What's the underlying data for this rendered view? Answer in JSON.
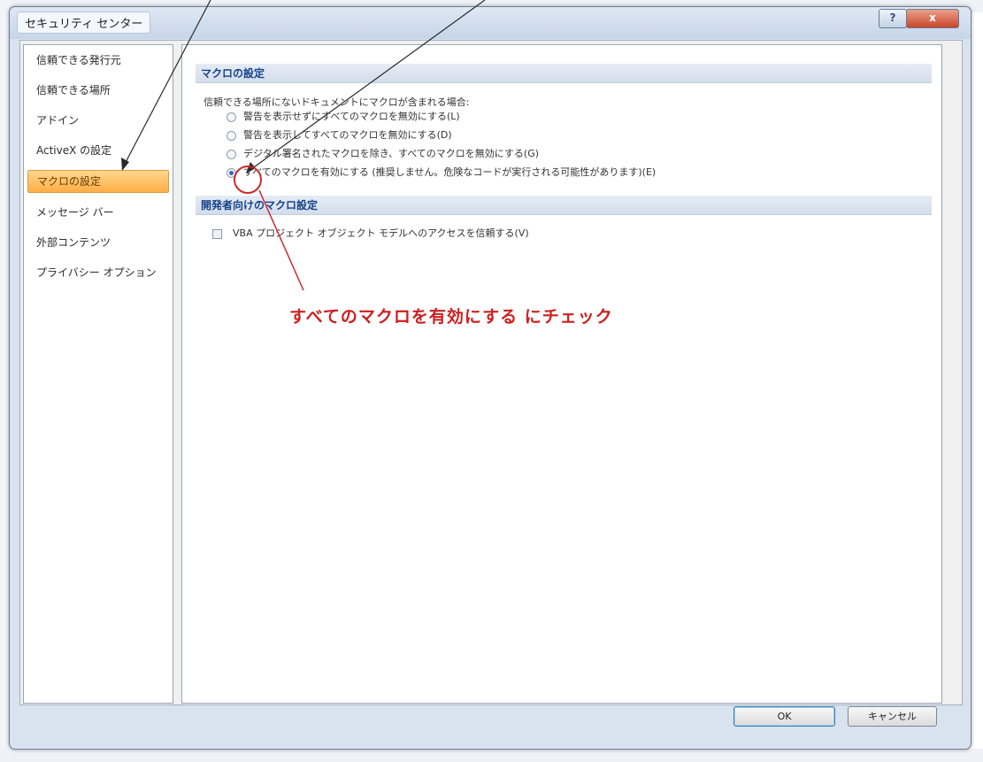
{
  "window": {
    "title": "セキュリティ センター",
    "help_button": "?",
    "close_button": "x"
  },
  "sidebar": {
    "items": [
      {
        "label": "信頼できる発行元"
      },
      {
        "label": "信頼できる場所"
      },
      {
        "label": "アドイン"
      },
      {
        "label": "ActiveX の設定"
      },
      {
        "label": "マクロの設定"
      },
      {
        "label": "メッセージ バー"
      },
      {
        "label": "外部コンテンツ"
      },
      {
        "label": "プライバシー オプション"
      }
    ],
    "active_index": 4
  },
  "macro_settings": {
    "header": "マクロの設定",
    "description": "信頼できる場所にないドキュメントにマクロが含まれる場合:",
    "options": [
      {
        "label": "警告を表示せずにすべてのマクロを無効にする(L)",
        "checked": false
      },
      {
        "label": "警告を表示してすべてのマクロを無効にする(D)",
        "checked": false
      },
      {
        "label": "デジタル署名されたマクロを除き、すべてのマクロを無効にする(G)",
        "checked": false
      },
      {
        "label": "すべてのマクロを有効にする (推奨しません。危険なコードが実行される可能性があります)(E)",
        "checked": true
      }
    ]
  },
  "developer_settings": {
    "header": "開発者向けのマクロ設定",
    "checkbox_label": "VBA プロジェクト オブジェクト モデルへのアクセスを信頼する(V)",
    "checked": false
  },
  "footer": {
    "ok_label": "OK",
    "cancel_label": "キャンセル"
  },
  "annotation": {
    "text": "すべてのマクロを有効にする にチェック",
    "color": "#cc1f1f"
  }
}
